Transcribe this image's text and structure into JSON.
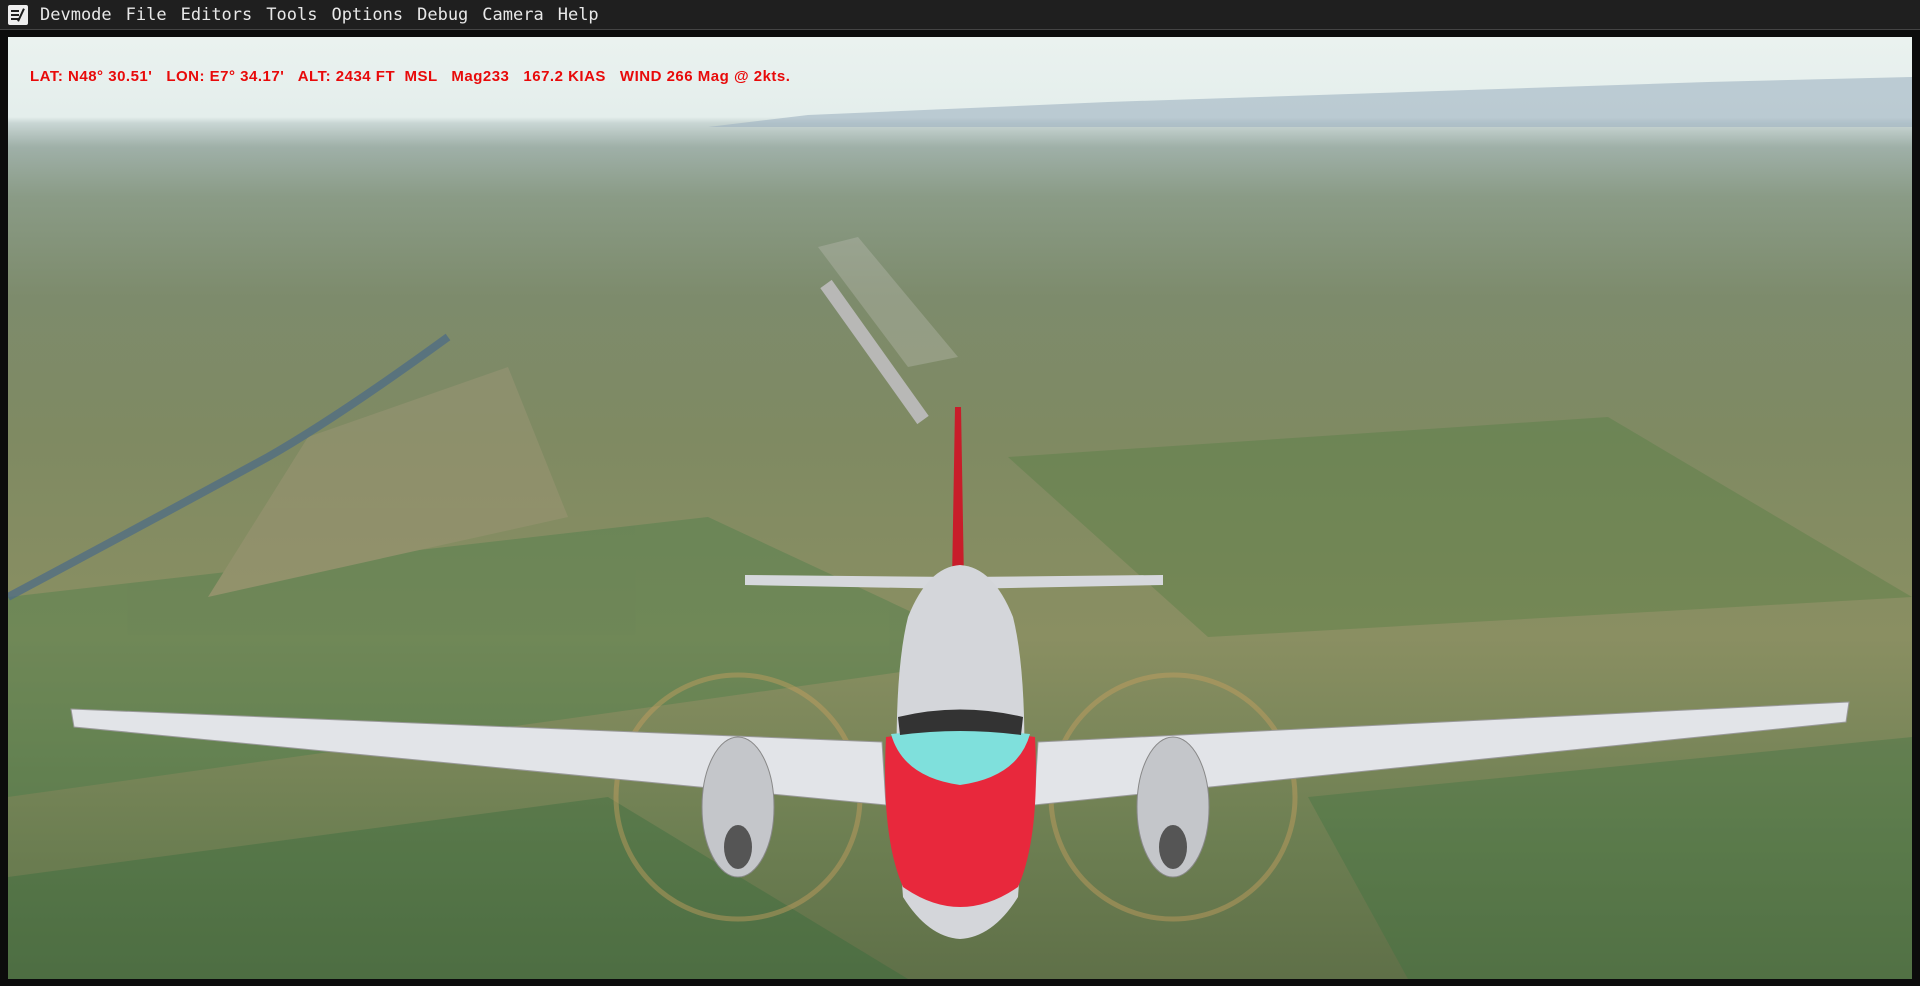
{
  "menubar": {
    "items": [
      "Devmode",
      "File",
      "Editors",
      "Tools",
      "Options",
      "Debug",
      "Camera",
      "Help"
    ]
  },
  "hud": {
    "text": "LAT: N48° 30.51'   LON: E7° 34.17'   ALT: 2434 FT  MSL   Mag233   167.2 KIAS   WIND 266 Mag @ 2kts."
  },
  "colors": {
    "hud": "#e80a0a",
    "menubar": "#1f1f1f",
    "livery_red": "#e8283c",
    "livery_cyan": "#7fe0dc"
  }
}
